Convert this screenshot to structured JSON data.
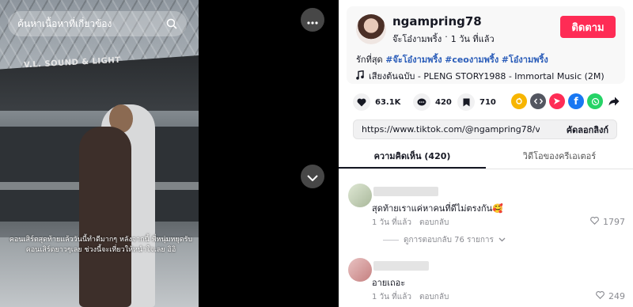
{
  "video": {
    "search_placeholder": "ค้นหาเนื้อหาที่เกี่ยวข้อง",
    "brand_text": "V.L. SOUND & LIGHT",
    "caption": "คอนเสิร์ตสุดท้ายแล้ววันนี้ทำดีมากๆ หลังจากนี้ พี่หนุ่มหยุดรับคอนเสิร์ตยาวๆเลย ช่วงนี้จะเที่ยวให้หนำใจเลย อิอิ"
  },
  "author": {
    "username": "ngampring78",
    "display_name": "จ๊ะโอ๋งามพริ้ง",
    "separator": "·",
    "time": "1 วัน ที่แล้ว",
    "follow_label": "ติดตาม"
  },
  "description": {
    "prefix": "รักที่สุด",
    "hashtags": [
      "#จ๊ะโอ๋งามพริ้ง",
      "#ceoงามพริ้ง",
      "#โอ๋งามพริ้ง"
    ]
  },
  "music": {
    "label": "เสียงต้นฉบับ - PLENG STORY1988 - Immortal Music (2M)"
  },
  "stats": {
    "likes": "63.1K",
    "comments": "420",
    "saves": "710"
  },
  "share_icons": [
    "embed-icon",
    "code-icon",
    "send-icon",
    "facebook-icon",
    "whatsapp-icon",
    "share-arrow-icon"
  ],
  "link": {
    "url": "https://www.tiktok.com/@ngampring78/video/764...",
    "copy_label": "คัดลอกลิงก์"
  },
  "tabs": {
    "comments": "ความคิดเห็น (420)",
    "creator_videos": "วิดีโอของครีเอเตอร์"
  },
  "comments": [
    {
      "text": "สุดท้ายเราแค่หาคนที่ดีไม่ตรงกัน🥰",
      "time": "1 วัน ที่แล้ว",
      "reply_label": "ตอบกลับ",
      "likes": "1797",
      "view_replies": "ดูการตอบกลับ 76 รายการ"
    },
    {
      "text": "อายเถอะ",
      "time": "1 วัน ที่แล้ว",
      "reply_label": "ตอบกลับ",
      "likes": "249"
    }
  ],
  "colors": {
    "accent": "#fe2c55",
    "hashtag": "#2b5db9",
    "muted": "#8a8b91"
  }
}
